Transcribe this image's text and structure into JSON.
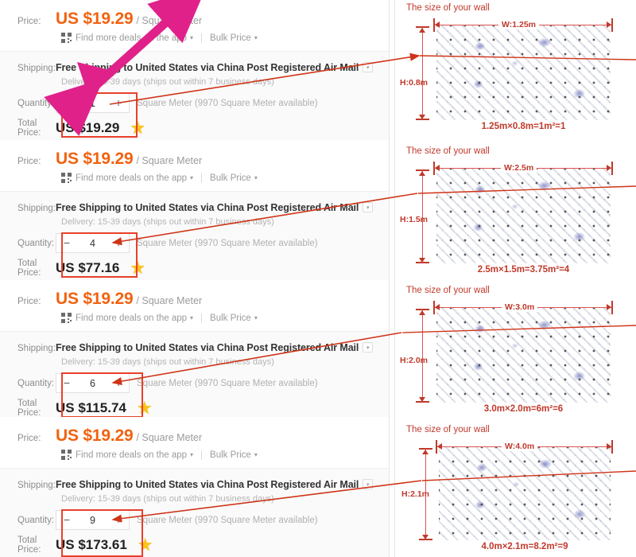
{
  "labels": {
    "price": "Price:",
    "shipping": "Shipping:",
    "quantity": "Quantity:",
    "total_price": "Total Price:"
  },
  "common": {
    "unit_price": "US $19.29",
    "unit_suffix": "/ Square Meter",
    "app_deals": "Find more deals on the app",
    "bulk_price": "Bulk Price",
    "shipping_text": "Free Shipping to United States via China Post Registered Air Mail",
    "delivery_text": "Delivery: 15-39 days (ships out within 7 business days)",
    "availability": "Square Meter (9970 Square Meter available)",
    "qr_icon": "qr-code-icon",
    "caret_icon": "chevron-down-icon",
    "select_icon": "chevron-down-icon",
    "star_icon": "star-icon",
    "minus_icon": "minus-icon",
    "plus_icon": "plus-icon",
    "accent_orange": "#f2620f",
    "highlight_red": "#e8402a",
    "diagram_red": "#c0392b",
    "magenta": "#e0218a",
    "star_yellow": "#fcc419"
  },
  "offers": [
    {
      "quantity": "1",
      "total": "US $19.29"
    },
    {
      "quantity": "4",
      "total": "US $77.16"
    },
    {
      "quantity": "6",
      "total": "US $115.74"
    },
    {
      "quantity": "9",
      "total": "US $173.61"
    }
  ],
  "diagrams": [
    {
      "title": "The size of your wall",
      "width_label": "W:1.25m",
      "height_label": "H:0.8m",
      "formula": "1.25m×0.8m=1m²=1"
    },
    {
      "title": "The size of your wall",
      "width_label": "W:2.5m",
      "height_label": "H:1.5m",
      "formula": "2.5m×1.5m=3.75m²=4"
    },
    {
      "title": "The size of your wall",
      "width_label": "W:3.0m",
      "height_label": "H:2.0m",
      "formula": "3.0m×2.0m=6m²=6"
    },
    {
      "title": "The size of your wall",
      "width_label": "W:4.0m",
      "height_label": "H:2.1m",
      "formula": "4.0m×2.1m=8.2m²=9"
    }
  ],
  "annotations": {
    "magenta_arrow": "double-headed-magenta-arrow",
    "red_arrows": "red-pointer-arrows",
    "qty_highlight": "red-rectangle-highlight"
  }
}
